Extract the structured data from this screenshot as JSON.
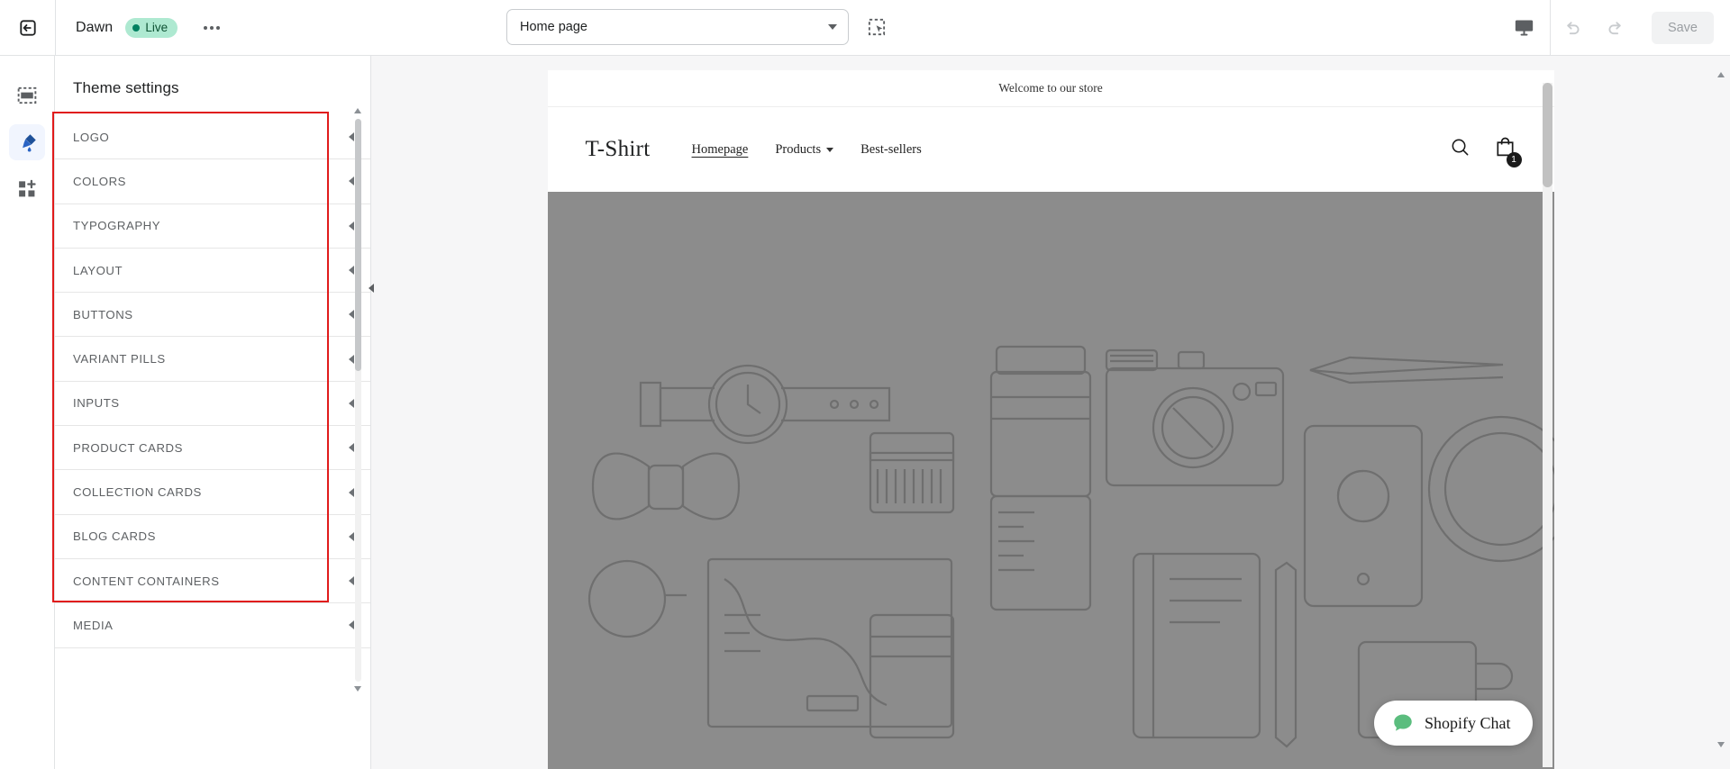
{
  "topbar": {
    "exit_icon": "exit-arrow-icon",
    "theme_name": "Dawn",
    "status_label": "Live",
    "more_label": "•••",
    "page_selector": {
      "value": "Home page",
      "caret_icon": "chevron-down-icon"
    },
    "inspect_icon": "select-region-icon",
    "device_icon": "desktop-monitor-icon",
    "undo_icon": "undo-icon",
    "redo_icon": "redo-icon",
    "save_label": "Save"
  },
  "rail": {
    "items": [
      {
        "name": "sections-icon",
        "label": "Sections",
        "active": false
      },
      {
        "name": "paint-brush-icon",
        "label": "Theme settings",
        "active": true
      },
      {
        "name": "apps-grid-plus-icon",
        "label": "Apps",
        "active": false
      }
    ]
  },
  "sidebar": {
    "title": "Theme settings",
    "arrow_icon": "chevron-right-icon",
    "items": [
      {
        "label": "LOGO"
      },
      {
        "label": "COLORS"
      },
      {
        "label": "TYPOGRAPHY"
      },
      {
        "label": "LAYOUT"
      },
      {
        "label": "BUTTONS"
      },
      {
        "label": "VARIANT PILLS"
      },
      {
        "label": "INPUTS"
      },
      {
        "label": "PRODUCT CARDS"
      },
      {
        "label": "COLLECTION CARDS"
      },
      {
        "label": "BLOG CARDS"
      },
      {
        "label": "CONTENT CONTAINERS"
      },
      {
        "label": "MEDIA"
      }
    ],
    "collapse_icon": "collapse-panel-icon",
    "scroll_up_icon": "scroll-up-arrow",
    "scroll_down_icon": "scroll-down-arrow"
  },
  "preview": {
    "announcement": "Welcome to our store",
    "store_logo": "T-Shirt",
    "nav": [
      {
        "label": "Homepage",
        "active": true,
        "has_chevron": false
      },
      {
        "label": "Products",
        "active": false,
        "has_chevron": true
      },
      {
        "label": "Best-sellers",
        "active": false,
        "has_chevron": false
      }
    ],
    "search_icon": "search-icon",
    "cart_icon": "shopping-bag-icon",
    "cart_count": "1",
    "hero_alt": "grey-placeholder-hero-image",
    "chat": {
      "label": "Shopify Chat",
      "icon": "chat-bubble-icon"
    },
    "scroll_up_icon": "scroll-up-arrow",
    "scroll_down_icon": "scroll-down-arrow"
  },
  "annotation": {
    "color": "#e01b1b"
  }
}
